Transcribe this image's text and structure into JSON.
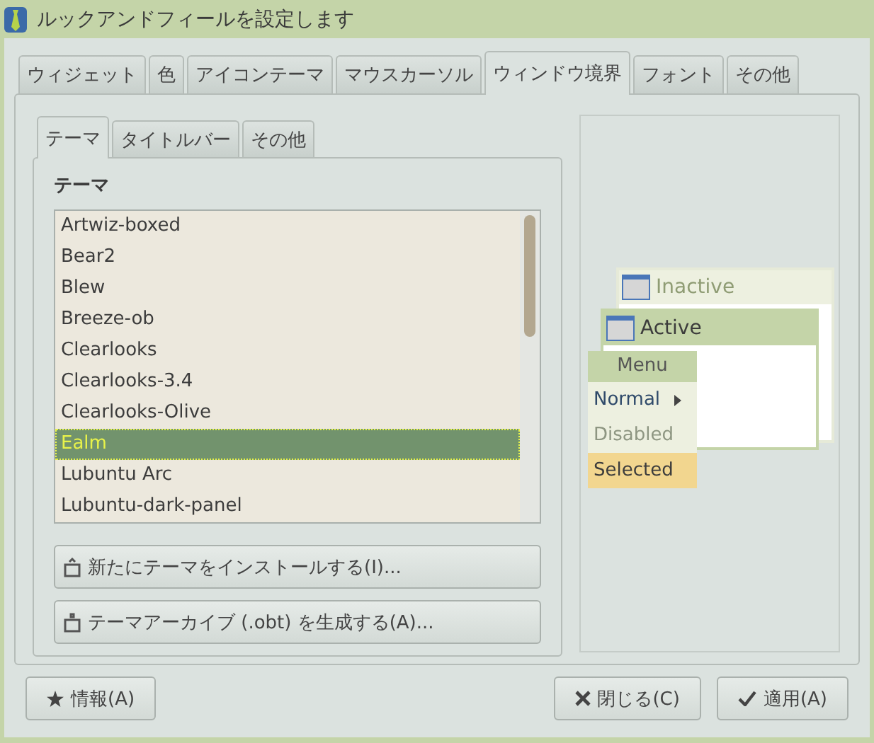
{
  "window": {
    "title": "ルックアンドフィールを設定します"
  },
  "tabs": [
    {
      "label": "ウィジェット",
      "selected": false
    },
    {
      "label": "色",
      "selected": false
    },
    {
      "label": "アイコンテーマ",
      "selected": false
    },
    {
      "label": "マウスカーソル",
      "selected": false
    },
    {
      "label": "ウィンドウ境界",
      "selected": true
    },
    {
      "label": "フォント",
      "selected": false
    },
    {
      "label": "その他",
      "selected": false
    }
  ],
  "subtabs": [
    {
      "label": "テーマ",
      "selected": true
    },
    {
      "label": "タイトルバー",
      "selected": false
    },
    {
      "label": "その他",
      "selected": false
    }
  ],
  "theme_section": {
    "heading": "テーマ",
    "items": [
      {
        "name": "Artwiz-boxed",
        "selected": false
      },
      {
        "name": "Bear2",
        "selected": false
      },
      {
        "name": "Blew",
        "selected": false
      },
      {
        "name": "Breeze-ob",
        "selected": false
      },
      {
        "name": "Clearlooks",
        "selected": false
      },
      {
        "name": "Clearlooks-3.4",
        "selected": false
      },
      {
        "name": "Clearlooks-Olive",
        "selected": false
      },
      {
        "name": "Ealm",
        "selected": true
      },
      {
        "name": "Lubuntu Arc",
        "selected": false
      },
      {
        "name": "Lubuntu-dark-panel",
        "selected": false
      }
    ]
  },
  "theme_buttons": [
    {
      "label": "新たにテーマをインストールする(I)...",
      "kind": "install"
    },
    {
      "label": "テーマアーカイブ (.obt) を生成する(A)...",
      "kind": "archive"
    }
  ],
  "preview": {
    "inactive_title": "Inactive",
    "active_title": "Active",
    "menu": {
      "title": "Menu",
      "items": [
        {
          "label": "Normal",
          "kind": "submenu"
        },
        {
          "label": "Disabled",
          "kind": "disabled"
        },
        {
          "label": "Selected",
          "kind": "selected"
        }
      ]
    }
  },
  "buttons": {
    "about": "情報(A)",
    "close": "閉じる(C)",
    "apply": "適用(A)"
  }
}
